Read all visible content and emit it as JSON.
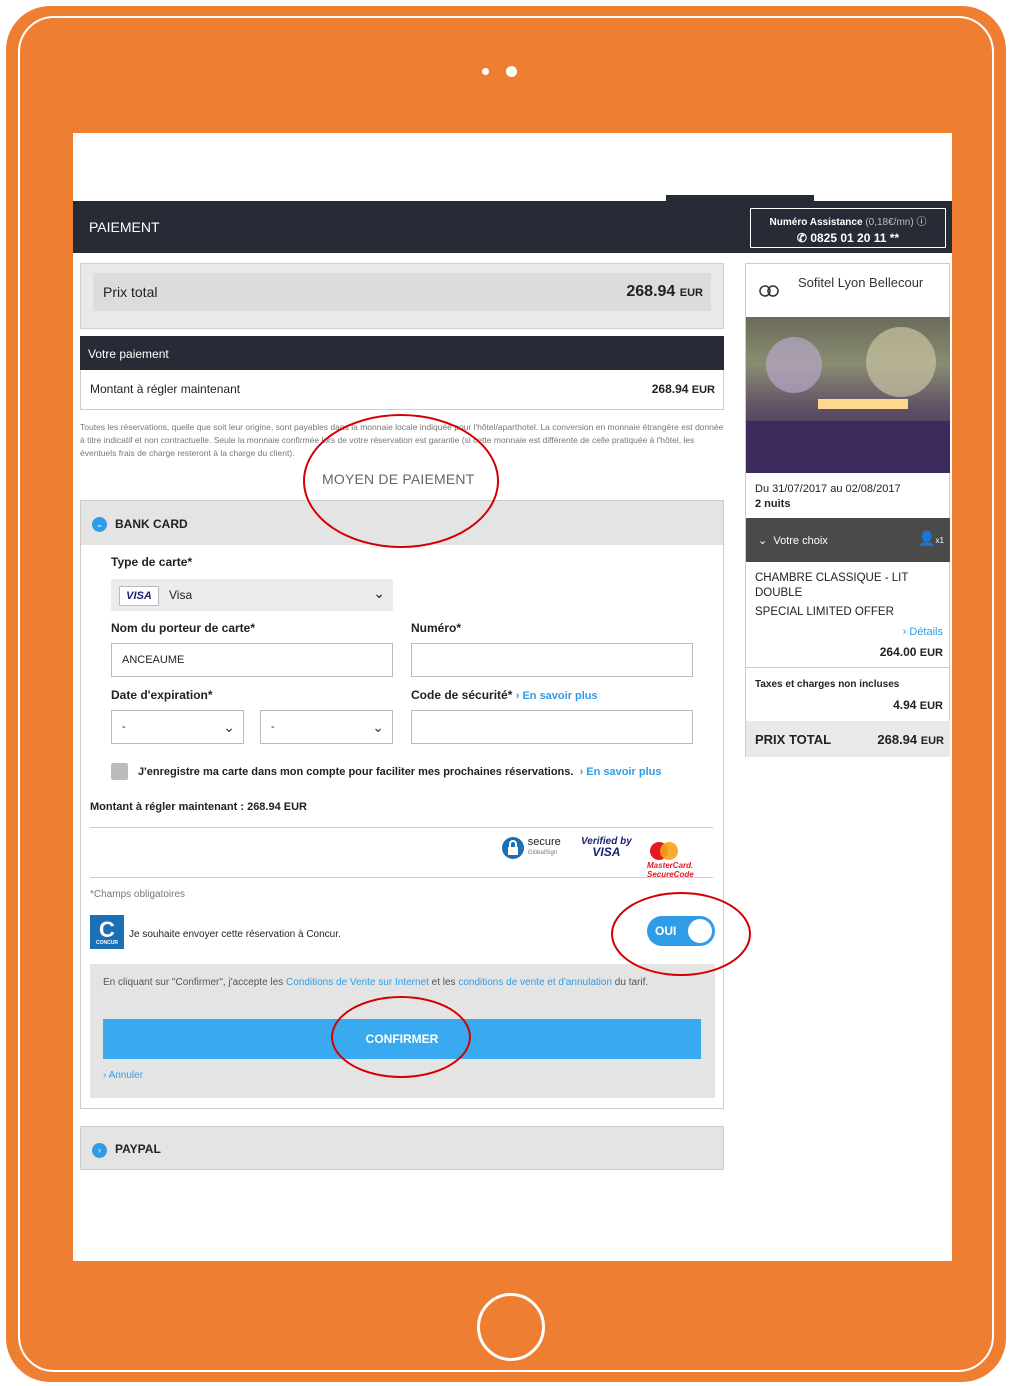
{
  "header": {
    "title": "PAIEMENT",
    "assistance_label": "Numéro Assistance",
    "assistance_rate": "(0,18€/mn)",
    "assistance_info_icon": "info-icon",
    "assistance_phone": "0825 01 20 11 **"
  },
  "price_total": {
    "label": "Prix total",
    "amount": "268.94",
    "currency": "EUR"
  },
  "payment": {
    "heading": "Votre paiement",
    "amount_now_label": "Montant à régler maintenant",
    "amount_now": "268.94",
    "currency": "EUR",
    "disclaimer": "Toutes les réservations, quelle que soit leur origine, sont payables dans la monnaie locale indiquée pour l'hôtel/aparthotel. La conversion en monnaie étrangère est donnée à titre indicatif et non contractuelle. Seule la monnaie confirmée lors de votre réservation est garantie (si cette monnaie est différente de celle pratiquée à l'hôtel, les éventuels frais de charge resteront à la charge du client)."
  },
  "moyen_label": "MOYEN DE PAIEMENT",
  "bank_card": {
    "title": "BANK CARD",
    "card_type_label": "Type de carte*",
    "card_type_logo": "VISA",
    "card_type_value": "Visa",
    "holder_label": "Nom du porteur de carte*",
    "holder_value": "ANCEAUME",
    "number_label": "Numéro*",
    "number_value": "",
    "expiry_label": "Date d'expiration*",
    "expiry_month": "-",
    "expiry_year": "-",
    "security_label": "Code de sécurité*",
    "security_link": "En savoir plus",
    "security_value": "",
    "save_card_label": "J'enregistre ma carte dans mon compte pour faciliter mes prochaines réservations.",
    "save_card_link": "En savoir plus",
    "amount_line": "Montant à régler maintenant :  268.94 EUR",
    "badges": {
      "secure": "secure",
      "secure_sub": "GlobalSign",
      "verified_by": "Verified by",
      "verified_visa": "VISA",
      "mastercard": "MasterCard.",
      "mastercard_sub": "SecureCode"
    },
    "required_note": "*Champs obligatoires",
    "concur_logo": "C",
    "concur_sub": "CONCUR",
    "concur_label": "Je souhaite envoyer cette réservation à Concur.",
    "concur_toggle": "OUI",
    "terms_prefix": "En cliquant sur \"Confirmer\", j'accepte les ",
    "terms_link1": "Conditions de Vente sur Internet",
    "terms_mid": " et les ",
    "terms_link2": "conditions de vente et d'annulation",
    "terms_suffix": " du tarif.",
    "confirm_button": "CONFIRMER",
    "cancel_link": "Annuler"
  },
  "paypal": {
    "title": "PAYPAL"
  },
  "sidebar": {
    "hotel_name": "Sofitel Lyon Bellecour",
    "dates": "Du 31/07/2017 au 02/08/2017",
    "nights": "2 nuits",
    "choice_label": "Votre choix",
    "guests": "x1",
    "room_name": "CHAMBRE CLASSIQUE - LIT DOUBLE",
    "offer": "SPECIAL LIMITED OFFER",
    "details_link": "Détails",
    "room_price": "264.00",
    "currency": "EUR",
    "taxes_label": "Taxes et charges non incluses",
    "taxes_price": "4.94",
    "total_label": "PRIX TOTAL",
    "total_price": "268.94"
  },
  "colors": {
    "device_frame": "#ee7f32",
    "header_bg": "#262b36",
    "accent_blue": "#3aaaf0",
    "annotation_red": "#d40000"
  }
}
